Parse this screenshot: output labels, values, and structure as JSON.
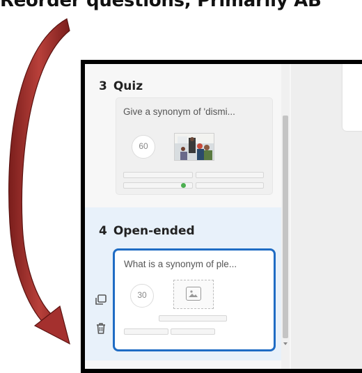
{
  "caption": {
    "text": "Reorder questions, Primarily AB"
  },
  "slides": [
    {
      "number": "3",
      "type": "Quiz",
      "question": "Give a synonym of 'dismi...",
      "timer": "60",
      "selected": false
    },
    {
      "number": "4",
      "type": "Open-ended",
      "question": "What is a synonym of ple...",
      "timer": "30",
      "selected": true
    }
  ],
  "tools": {
    "duplicate_icon": "copy-icon",
    "delete_icon": "trash-icon"
  },
  "colors": {
    "arrow": "#a4302e",
    "selected_border": "#1f6cc4",
    "selected_bg": "#e8f1fa",
    "correct_dot": "#4caf50"
  }
}
